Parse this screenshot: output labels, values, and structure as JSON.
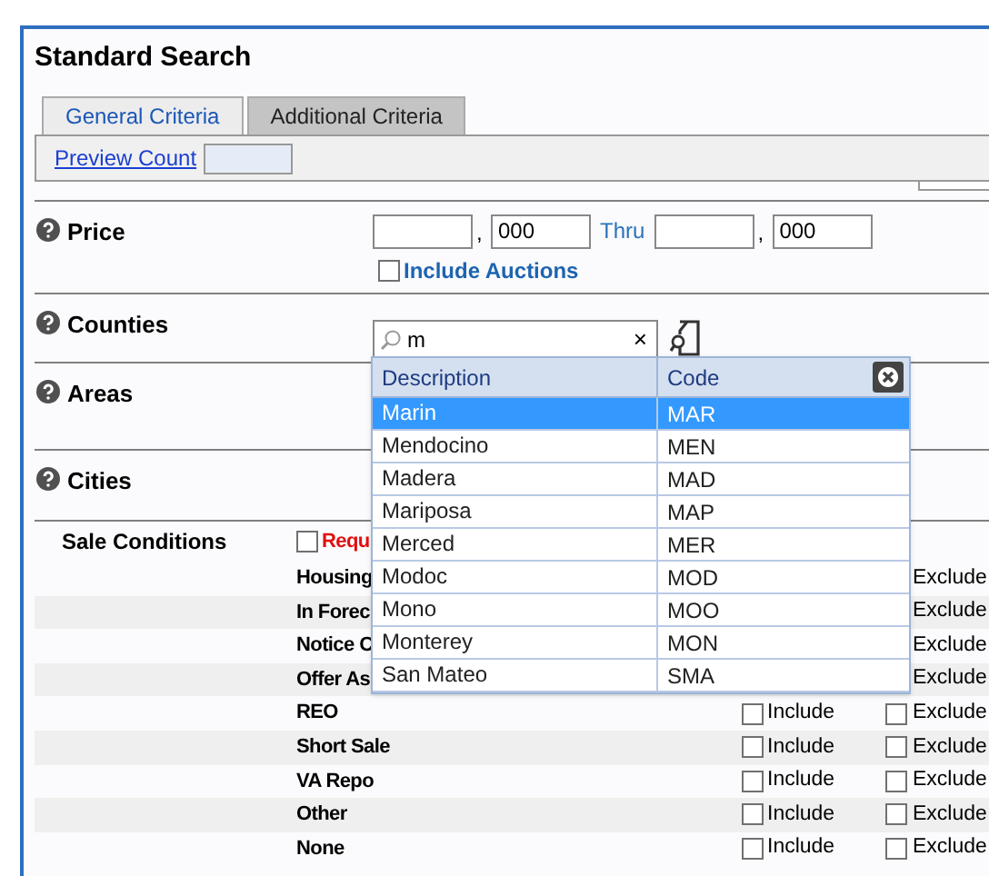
{
  "title": "Standard Search",
  "tabs": [
    {
      "label": "General Criteria",
      "selected": true
    },
    {
      "label": "Additional Criteria",
      "selected": false
    }
  ],
  "toolbar": {
    "link": "Preview Count"
  },
  "price": {
    "label": "Price",
    "separator": ",",
    "from_thousands": "000",
    "thru": "Thru",
    "to_thousands": "000",
    "auctions": {
      "label": "Include Auctions",
      "checked": false
    }
  },
  "counties": {
    "label": "Counties",
    "search_value": "m",
    "clear": "×"
  },
  "areas": {
    "label": "Areas"
  },
  "cities": {
    "label": "Cities"
  },
  "sale_conditions": {
    "label": "Sale Conditions",
    "required": {
      "label": "Requ",
      "checked": false
    },
    "rows": [
      {
        "label": "Housing",
        "exclude": {
          "label": "Exclude"
        }
      },
      {
        "label": "In Forec",
        "exclude": {
          "label": "Exclude"
        }
      },
      {
        "label": "Notice C",
        "exclude": {
          "label": "Exclude"
        }
      },
      {
        "label": "Offer As",
        "exclude": {
          "label": "Exclude"
        }
      },
      {
        "label": "REO",
        "include": {
          "label": "Include",
          "checked": false
        },
        "exclude": {
          "label": "Exclude",
          "checked": false
        }
      },
      {
        "label": "Short Sale",
        "include": {
          "label": "Include",
          "checked": false
        },
        "exclude": {
          "label": "Exclude",
          "checked": false
        }
      },
      {
        "label": "VA Repo",
        "include": {
          "label": "Include",
          "checked": false
        },
        "exclude": {
          "label": "Exclude",
          "checked": false
        }
      },
      {
        "label": "Other",
        "include": {
          "label": "Include",
          "checked": false
        },
        "exclude": {
          "label": "Exclude",
          "checked": false
        }
      },
      {
        "label": "None",
        "include": {
          "label": "Include",
          "checked": false
        },
        "exclude": {
          "label": "Exclude",
          "checked": false
        }
      }
    ]
  },
  "dropdown": {
    "columns": [
      "Description",
      "Code"
    ],
    "rows": [
      {
        "description": "Marin",
        "code": "MAR",
        "selected": true
      },
      {
        "description": "Mendocino",
        "code": "MEN",
        "selected": false
      },
      {
        "description": "Madera",
        "code": "MAD",
        "selected": false
      },
      {
        "description": "Mariposa",
        "code": "MAP",
        "selected": false
      },
      {
        "description": "Merced",
        "code": "MER",
        "selected": false
      },
      {
        "description": "Modoc",
        "code": "MOD",
        "selected": false
      },
      {
        "description": "Mono",
        "code": "MOO",
        "selected": false
      },
      {
        "description": "Monterey",
        "code": "MON",
        "selected": false
      },
      {
        "description": "San Mateo",
        "code": "SMA",
        "selected": false
      }
    ]
  }
}
